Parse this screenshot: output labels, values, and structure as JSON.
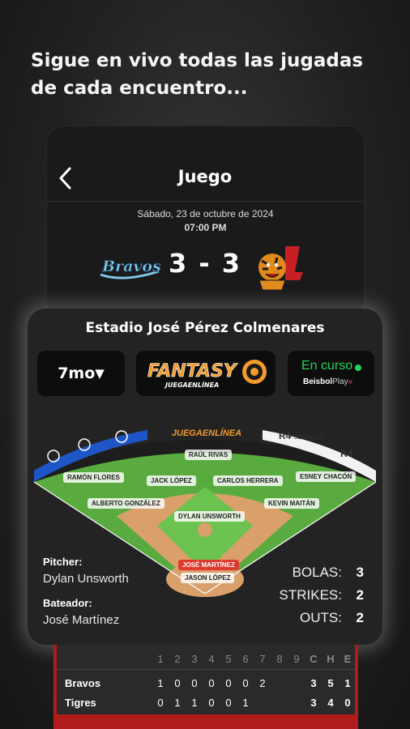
{
  "headline": "Sigue en vivo todas las jugadas de cada encuentro...",
  "header": {
    "title": "Juego",
    "date": "Sábado, 23 de octubre de 2024",
    "time": "07:00 PM"
  },
  "game": {
    "home_logo_text": "Bravos",
    "score": "3 - 3"
  },
  "card": {
    "stadium": "Estadio José Pérez Colmenares",
    "inning": "7mo",
    "inning_arrow": "▼",
    "fantasy_title": "FANTASY",
    "fantasy_subtitle": "JUEGAENLÍNEA",
    "status": "En curso",
    "beisbolplay_a": "Beisbol",
    "beisbolplay_b": "Play",
    "beisbolplay_c": "»"
  },
  "field": {
    "banner": "JUEGAENLÍNEA",
    "r4_1": "R4",
    "r4_1_sub": "SENCILLO",
    "r4_2": "R4",
    "players": [
      "RAÚL RIVAS",
      "RAMÓN FLORES",
      "JACK LÓPEZ",
      "CARLOS HERRERA",
      "ESNEY CHACÓN",
      "ALBERTO GONZÁLEZ",
      "KEVIN MAITÁN",
      "DYLAN UNSWORTH",
      "JOSÉ MARTÍNEZ",
      "JASON LÓPEZ"
    ]
  },
  "matchup": {
    "pitcher_label": "Pitcher:",
    "pitcher": "Dylan Unsworth",
    "batter_label": "Bateador:",
    "batter": "José Martínez"
  },
  "count": {
    "balls_label": "BOLAS:",
    "balls": "3",
    "strikes_label": "STRIKES:",
    "strikes": "2",
    "outs_label": "OUTS:",
    "outs": "2"
  },
  "scoreboard": {
    "innings": [
      "1",
      "2",
      "3",
      "4",
      "5",
      "6",
      "7",
      "8",
      "9"
    ],
    "totals_headers": [
      "C",
      "H",
      "E"
    ],
    "rows": [
      {
        "team": "Bravos",
        "innings": [
          "1",
          "0",
          "0",
          "0",
          "0",
          "0",
          "2",
          "",
          ""
        ],
        "totals": [
          "3",
          "5",
          "1"
        ]
      },
      {
        "team": "Tigres",
        "innings": [
          "0",
          "1",
          "1",
          "0",
          "0",
          "1",
          "",
          "",
          ""
        ],
        "totals": [
          "3",
          "4",
          "0"
        ]
      }
    ]
  },
  "colors": {
    "accent_red": "#b01c1c",
    "live_green": "#27d35a",
    "fantasy_orange": "#f39a2b",
    "field_green": "#5aab3f"
  }
}
